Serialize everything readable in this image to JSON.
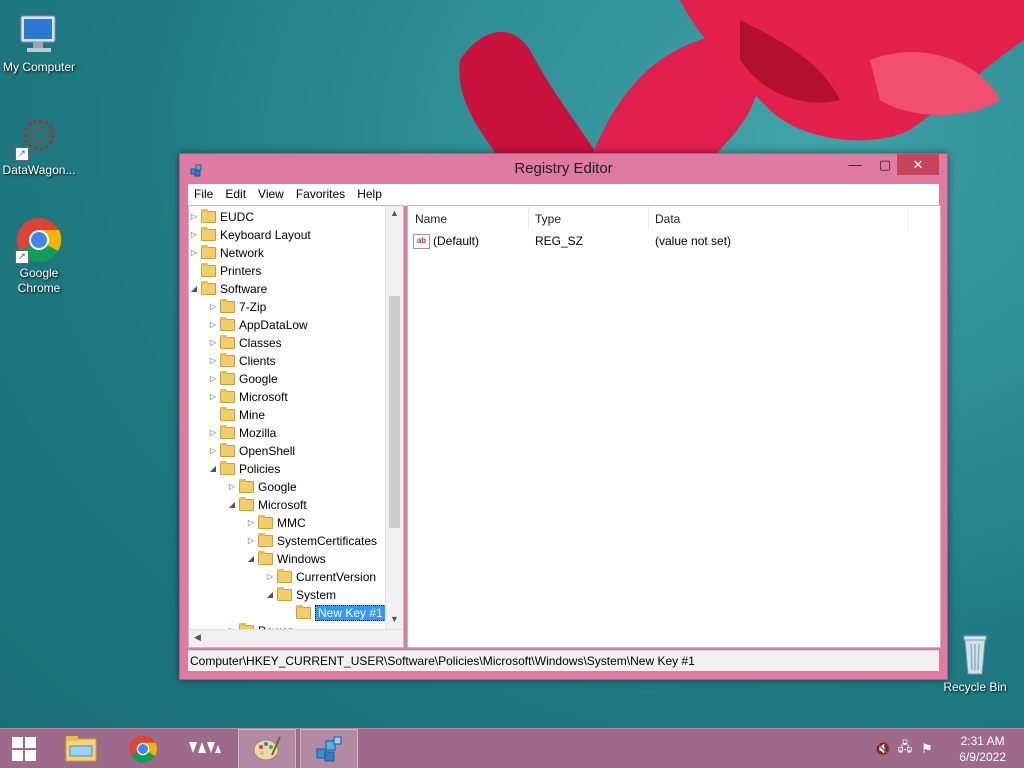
{
  "desktop": {
    "icons": [
      {
        "label": "My Computer"
      },
      {
        "label": "DataWagon..."
      },
      {
        "label": "Google Chrome"
      },
      {
        "label": "Recycle Bin"
      }
    ]
  },
  "window": {
    "title": "Registry Editor",
    "controls": {
      "minimize": "—",
      "maximize": "▢",
      "close": "✕"
    },
    "menu": [
      "File",
      "Edit",
      "View",
      "Favorites",
      "Help"
    ],
    "tree": [
      {
        "label": "EUDC",
        "expander": "▷"
      },
      {
        "label": "Keyboard Layout",
        "expander": "▷"
      },
      {
        "label": "Network",
        "expander": "▷"
      },
      {
        "label": "Printers",
        "expander": ""
      },
      {
        "label": "Software",
        "expander": "◢"
      },
      {
        "label": "7-Zip",
        "expander": "▷"
      },
      {
        "label": "AppDataLow",
        "expander": "▷"
      },
      {
        "label": "Classes",
        "expander": "▷"
      },
      {
        "label": "Clients",
        "expander": "▷"
      },
      {
        "label": "Google",
        "expander": "▷"
      },
      {
        "label": "Microsoft",
        "expander": "▷"
      },
      {
        "label": "Mine",
        "expander": ""
      },
      {
        "label": "Mozilla",
        "expander": "▷"
      },
      {
        "label": "OpenShell",
        "expander": "▷"
      },
      {
        "label": "Policies",
        "expander": "◢"
      },
      {
        "label": "Google",
        "expander": "▷"
      },
      {
        "label": "Microsoft",
        "expander": "◢"
      },
      {
        "label": "MMC",
        "expander": "▷"
      },
      {
        "label": "SystemCertificates",
        "expander": "▷"
      },
      {
        "label": "Windows",
        "expander": "◢"
      },
      {
        "label": "CurrentVersion",
        "expander": "▷"
      },
      {
        "label": "System",
        "expander": "◢"
      },
      {
        "label": "New Key #1",
        "expander": ""
      },
      {
        "label": "Power",
        "expander": "▷"
      }
    ],
    "columns": {
      "name": "Name",
      "type": "Type",
      "data": "Data"
    },
    "values": [
      {
        "name": "(Default)",
        "type": "REG_SZ",
        "data": "(value not set)"
      }
    ],
    "status_path": "Computer\\HKEY_CURRENT_USER\\Software\\Policies\\Microsoft\\Windows\\System\\New Key #1"
  },
  "taskbar": {
    "time": "2:31 AM",
    "date": "6/9/2022"
  }
}
